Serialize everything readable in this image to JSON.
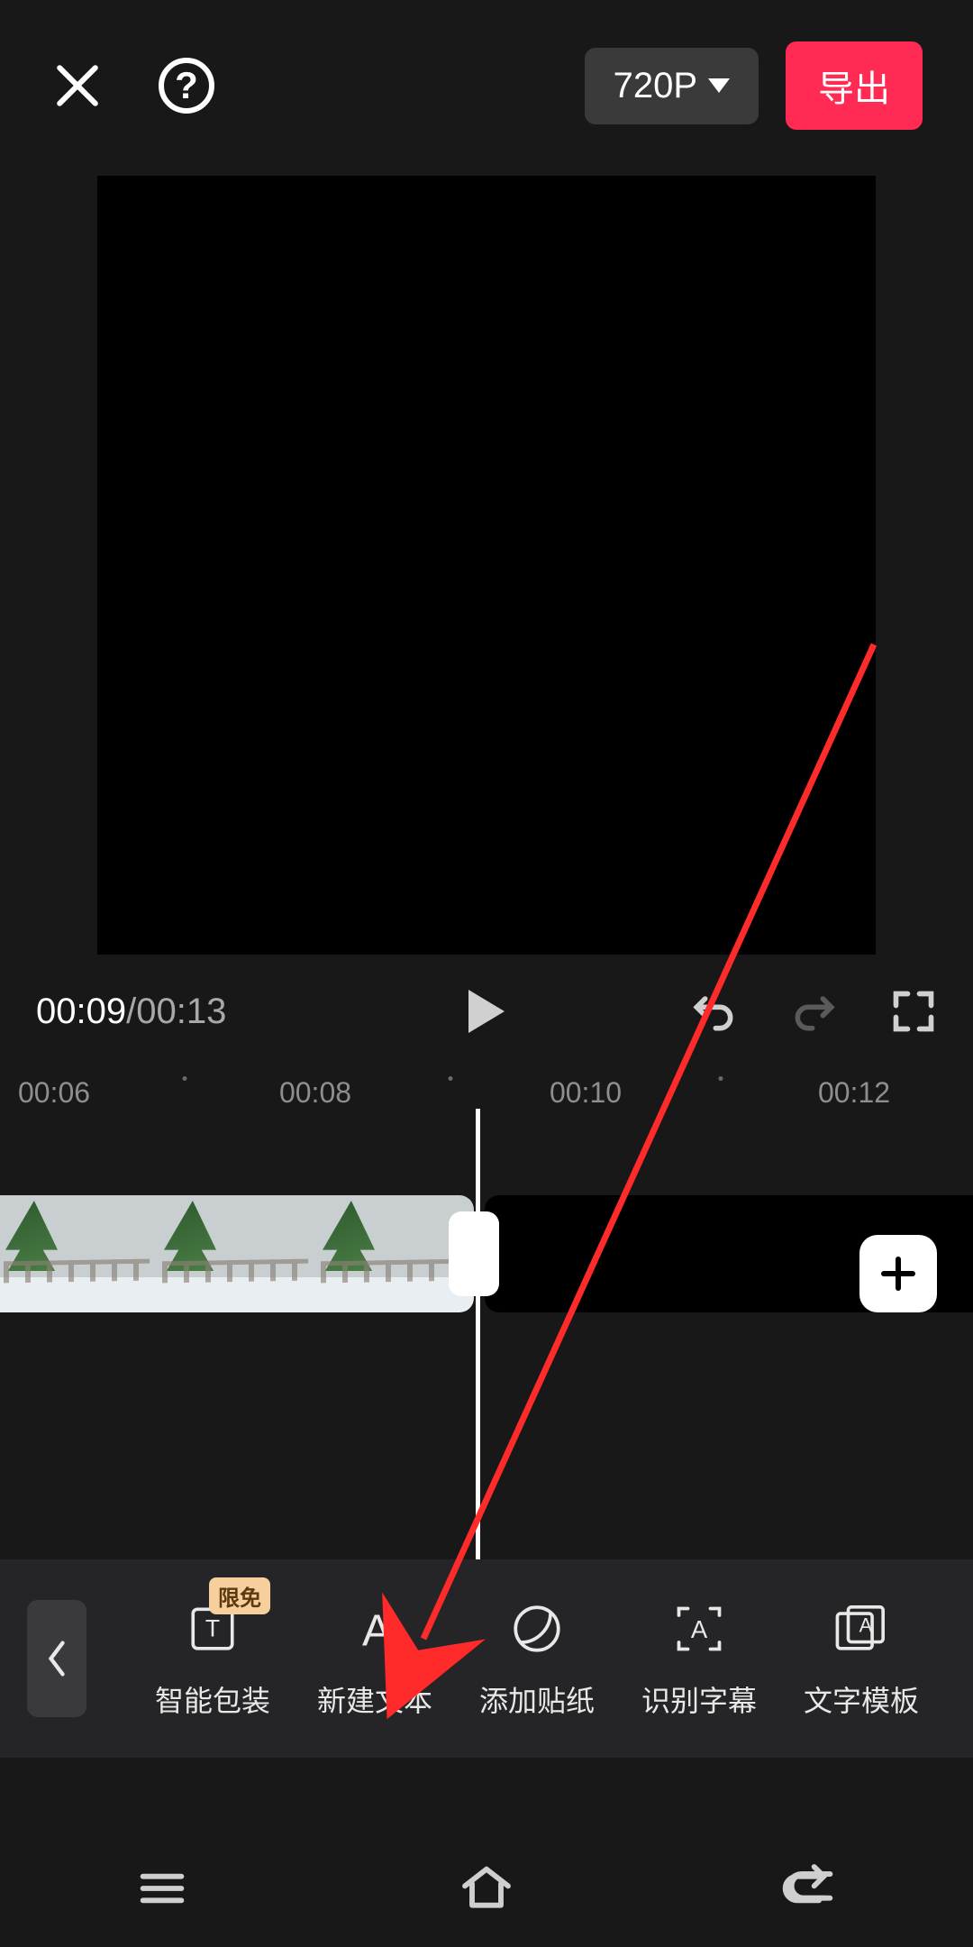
{
  "header": {
    "resolution_label": "720P",
    "export_label": "导出",
    "help_label": "?"
  },
  "playback": {
    "current_time": "00:09",
    "total_time": "00:13",
    "separator": " / "
  },
  "ruler": {
    "ticks": [
      "00:06",
      "00:08",
      "00:10",
      "00:12"
    ]
  },
  "toolbar": {
    "back_label": "",
    "items": [
      {
        "label": "智能包装",
        "icon": "smart-package-icon",
        "badge": "限免"
      },
      {
        "label": "新建文本",
        "icon": "new-text-icon"
      },
      {
        "label": "添加贴纸",
        "icon": "sticker-icon"
      },
      {
        "label": "识别字幕",
        "icon": "caption-recognize-icon"
      },
      {
        "label": "文字模板",
        "icon": "text-template-icon"
      }
    ]
  },
  "add_button_label": "+",
  "annotation": {
    "arrow_color": "#ff2a2a"
  }
}
